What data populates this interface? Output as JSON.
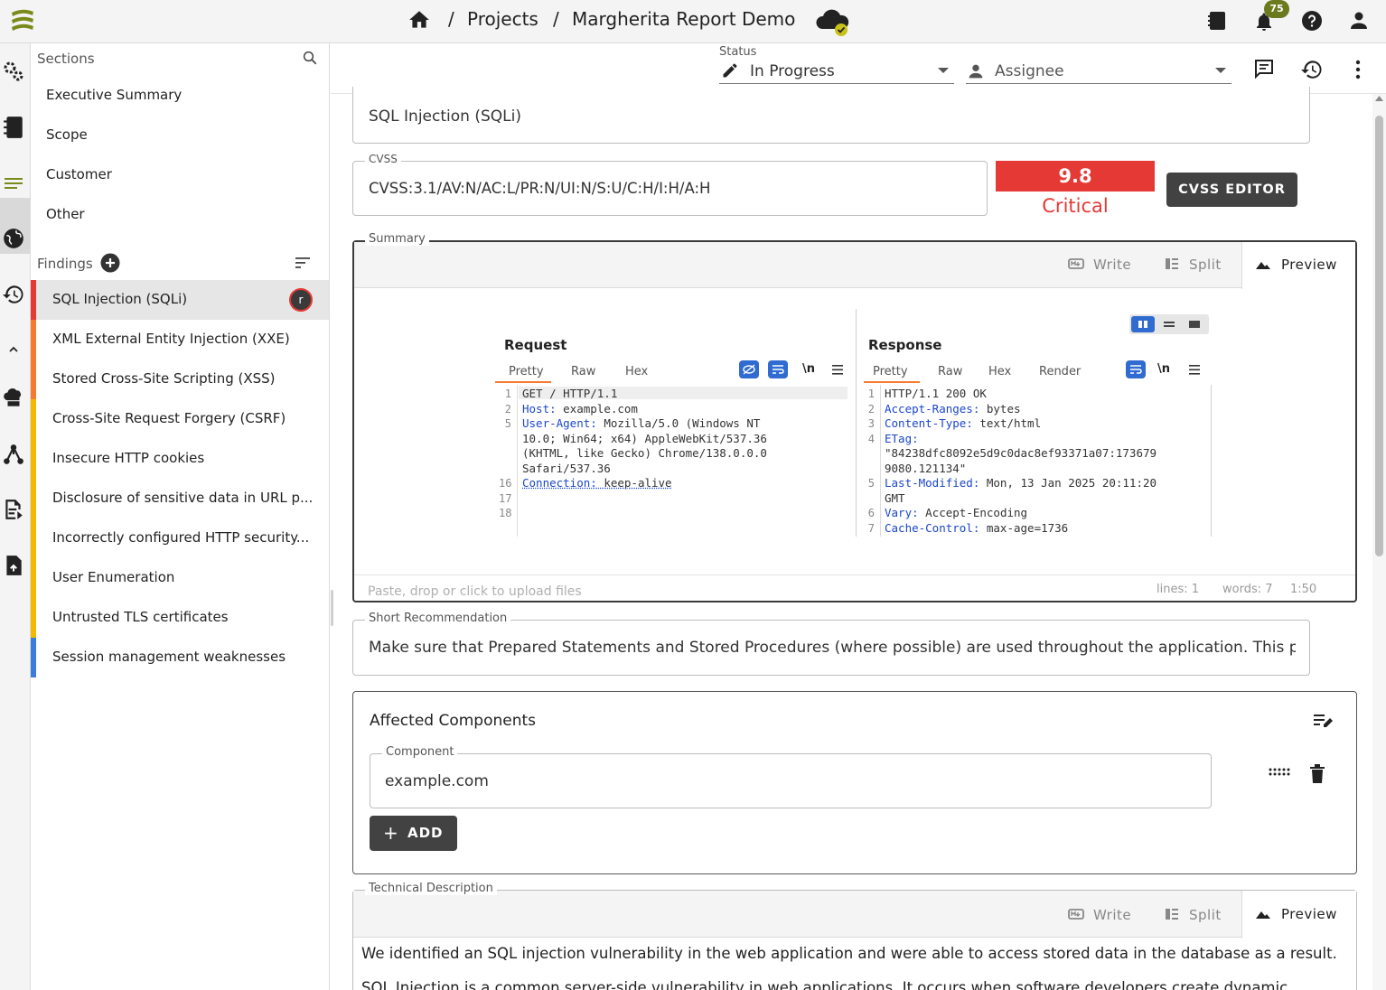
{
  "topbar": {
    "breadcrumb_sep": "/",
    "crumb_projects": "Projects",
    "crumb_project": "Margherita Report Demo",
    "notification_count": "75"
  },
  "sections_panel": {
    "sections_label": "Sections",
    "sections": [
      "Executive Summary",
      "Scope",
      "Customer",
      "Other"
    ],
    "findings_label": "Findings",
    "findings": [
      {
        "title": "SQL Injection (SQLi)",
        "color": "#e53935",
        "badge": "r"
      },
      {
        "title": "XML External Entity Injection (XXE)",
        "color": "#f57c2f"
      },
      {
        "title": "Stored Cross-Site Scripting (XSS)",
        "color": "#f57c2f"
      },
      {
        "title": "Cross-Site Request Forgery (CSRF)",
        "color": "#f5b800"
      },
      {
        "title": "Insecure HTTP cookies",
        "color": "#f5b800"
      },
      {
        "title": "Disclosure of sensitive data in URL p...",
        "color": "#f5b800"
      },
      {
        "title": "Incorrectly configured HTTP security...",
        "color": "#f5b800"
      },
      {
        "title": "User Enumeration",
        "color": "#f5b800"
      },
      {
        "title": "Untrusted TLS certificates",
        "color": "#f5b800"
      },
      {
        "title": "Session management weaknesses",
        "color": "#3b7dd8"
      }
    ]
  },
  "header": {
    "status_label": "Status",
    "status_value": "In Progress",
    "assignee_placeholder": "Assignee"
  },
  "finding": {
    "title_value": "SQL Injection (SQLi)",
    "cvss_label": "CVSS",
    "cvss_vector": "CVSS:3.1/AV:N/AC:L/PR:N/UI:N/S:U/C:H/I:H/A:H",
    "cvss_score": "9.8",
    "cvss_severity": "Critical",
    "cvss_editor_label": "CVSS EDITOR",
    "summary_label": "Summary",
    "tabs": {
      "write": "Write",
      "split": "Split",
      "preview": "Preview"
    },
    "upload_hint": "Paste, drop or click to upload files",
    "stats": {
      "lines": "lines: 1",
      "words": "words: 7",
      "pos": "1:50"
    },
    "short_rec_label": "Short Recommendation",
    "short_rec_value": "Make sure that Prepared Statements and Stored Procedures (where possible) are used throughout the application. This pr",
    "affected_title": "Affected Components",
    "component_label": "Component",
    "component_value": "example.com",
    "add_label": "ADD",
    "tech_desc_label": "Technical Description",
    "tech_desc_p1": "We identified an SQL injection vulnerability in the web application and were able to access stored data in the database as a result.",
    "tech_desc_p2": "SQL Injection is a common server-side vulnerability in web applications. It occurs when software developers create dynamic"
  },
  "burp": {
    "request_title": "Request",
    "response_title": "Response",
    "req_tabs": [
      "Pretty",
      "Raw",
      "Hex"
    ],
    "resp_tabs": [
      "Pretty",
      "Raw",
      "Hex",
      "Render"
    ],
    "newline_glyph": "\\n",
    "req_lines": [
      {
        "n": "1",
        "k": "",
        "v": "GET / HTTP/1.1"
      },
      {
        "n": "2",
        "k": "Host:",
        "v": " example.com"
      },
      {
        "n": "5",
        "k": "User-Agent:",
        "v": " Mozilla/5.0 (Windows NT"
      },
      {
        "n": "",
        "k": "",
        "v": "10.0; Win64; x64) AppleWebKit/537.36"
      },
      {
        "n": "",
        "k": "",
        "v": "(KHTML, like Gecko) Chrome/138.0.0.0"
      },
      {
        "n": "",
        "k": "",
        "v": "Safari/537.36"
      },
      {
        "n": "16",
        "k": "Connection:",
        "v": " keep-alive"
      },
      {
        "n": "17",
        "k": "",
        "v": ""
      },
      {
        "n": "18",
        "k": "",
        "v": ""
      }
    ],
    "resp_lines": [
      {
        "n": "1",
        "k": "",
        "v": "HTTP/1.1 200 OK"
      },
      {
        "n": "2",
        "k": "Accept-Ranges:",
        "v": " bytes"
      },
      {
        "n": "3",
        "k": "Content-Type:",
        "v": " text/html"
      },
      {
        "n": "4",
        "k": "ETag:",
        "v": ""
      },
      {
        "n": "",
        "k": "",
        "v": "\"84238dfc8092e5d9c0dac8ef93371a07:173679"
      },
      {
        "n": "",
        "k": "",
        "v": "9080.121134\""
      },
      {
        "n": "5",
        "k": "Last-Modified:",
        "v": " Mon, 13 Jan 2025 20:11:20"
      },
      {
        "n": "",
        "k": "",
        "v": " GMT"
      },
      {
        "n": "6",
        "k": "Vary:",
        "v": " Accept-Encoding"
      },
      {
        "n": "7",
        "k": "Cache-Control:",
        "v": " max-age=1736"
      }
    ]
  },
  "colors": {
    "critical": "#e53935",
    "dark_button": "#424242",
    "burp_blue": "#2f6bd0"
  }
}
